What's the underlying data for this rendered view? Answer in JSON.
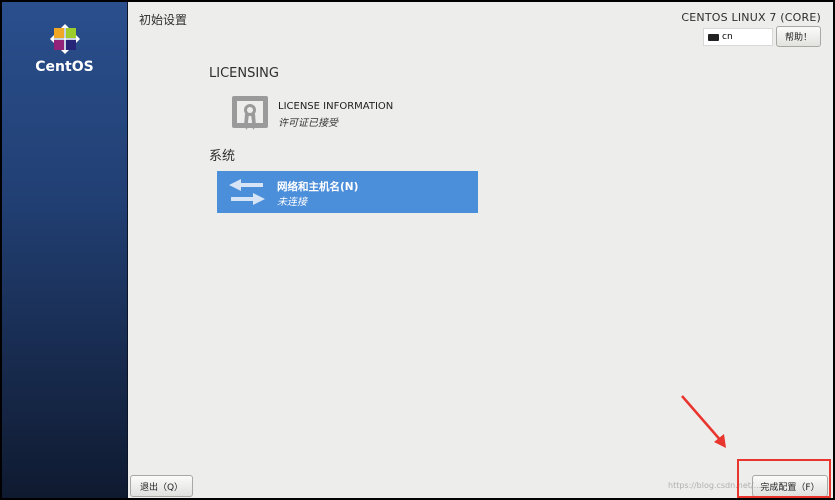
{
  "sidebar": {
    "logo_text": "CentOS"
  },
  "header": {
    "title": "初始设置",
    "product": "CENTOS LINUX 7 (CORE)",
    "keyboard_layout": "cn",
    "help_label": "帮助！"
  },
  "sections": [
    {
      "heading": "LICENSING",
      "spokes": [
        {
          "title": "LICENSE INFORMATION",
          "status": "许可证已接受",
          "icon": "license-certificate-icon"
        }
      ]
    },
    {
      "heading": "系统",
      "spokes": [
        {
          "title": "网络和主机名(N)",
          "status": "未连接",
          "icon": "network-arrows-icon",
          "selected": true
        }
      ]
    }
  ],
  "footer": {
    "quit_label": "退出（Q）",
    "finish_label": "完成配置（F）"
  },
  "watermark": "https://blog.csdn.net/...",
  "colors": {
    "sidebar_top": "#2a4f8d",
    "sidebar_bottom": "#0f1a30",
    "selected_spoke": "#4b8ed9",
    "annotation": "#e8352e"
  }
}
